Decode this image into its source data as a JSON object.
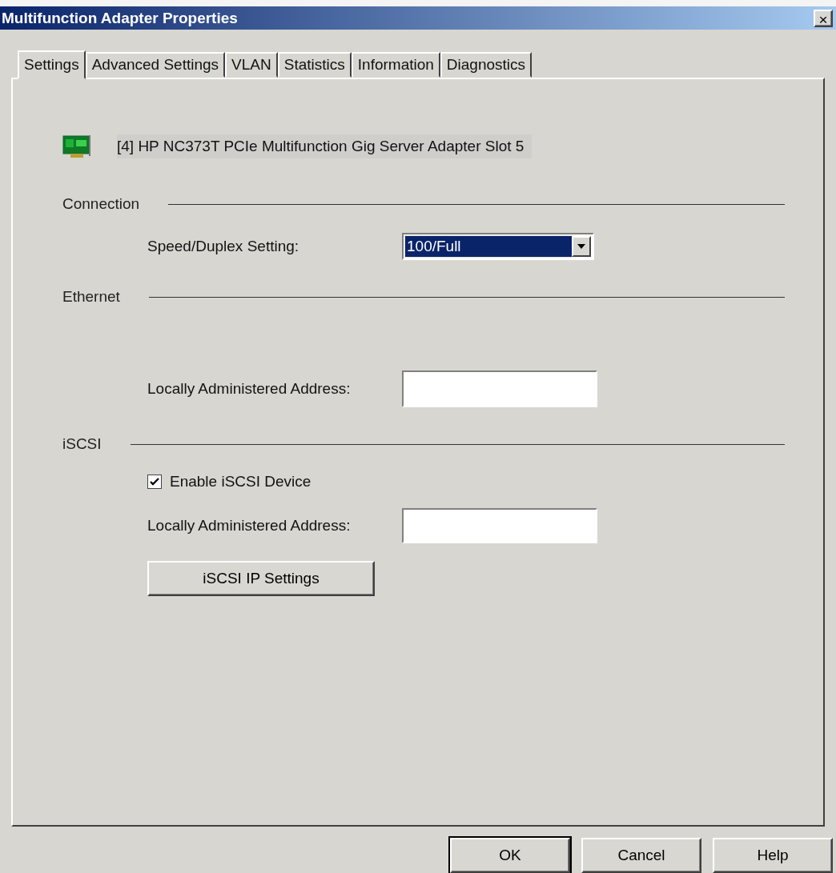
{
  "window": {
    "title": "Multifunction Adapter Properties",
    "close": "×"
  },
  "tabs": [
    {
      "label": "Settings",
      "selected": true
    },
    {
      "label": "Advanced Settings",
      "selected": false
    },
    {
      "label": "VLAN",
      "selected": false
    },
    {
      "label": "Statistics",
      "selected": false
    },
    {
      "label": "Information",
      "selected": false
    },
    {
      "label": "Diagnostics",
      "selected": false
    }
  ],
  "adapter": {
    "name": "[4] HP NC373T PCIe Multifunction Gig Server Adapter Slot 5"
  },
  "sections": [
    {
      "title": "Connection",
      "fields": [
        {
          "kind": "combo",
          "label": "Speed/Duplex Setting:",
          "value": "100/Full"
        }
      ]
    },
    {
      "title": "Ethernet",
      "fields": [
        {
          "kind": "text",
          "label": "Locally Administered Address:"
        }
      ]
    },
    {
      "title": "iSCSI",
      "fields": [
        {
          "kind": "checkbox",
          "label": "Enable iSCSI Device",
          "checked": true
        },
        {
          "kind": "text",
          "label": "Locally Administered Address:"
        },
        {
          "kind": "button",
          "label": "iSCSI IP Settings"
        }
      ]
    }
  ],
  "buttons": [
    {
      "label": "OK",
      "default": true
    },
    {
      "label": "Cancel",
      "default": false
    },
    {
      "label": "Help",
      "default": false
    }
  ]
}
